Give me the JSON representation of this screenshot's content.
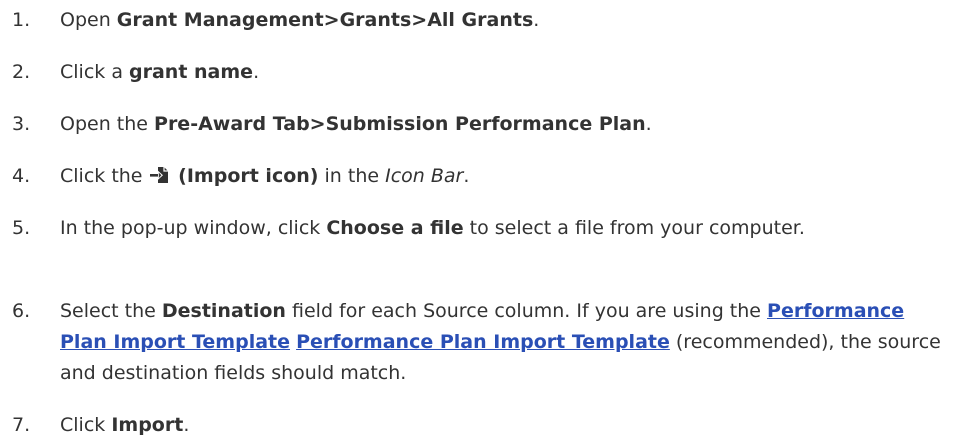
{
  "steps": [
    {
      "number": "1.",
      "pre": "Open ",
      "bold": "Grant Management>Grants>All Grants",
      "post": "."
    },
    {
      "number": "2.",
      "pre": "Click a ",
      "bold": "grant name",
      "post": "."
    },
    {
      "number": "3.",
      "pre": "Open the ",
      "bold": "Pre-Award Tab>Submission Performance Plan",
      "post": "."
    },
    {
      "number": "4.",
      "pre": "Click the ",
      "icon": "import-icon",
      "bold": " (Import icon)",
      "mid": " in the ",
      "italic": "Icon Bar",
      "post": "."
    },
    {
      "number": "5.",
      "pre": "In the pop-up window, click ",
      "bold": "Choose a file",
      "post": " to select a file from your computer."
    },
    {
      "number": "6.",
      "pre": "Select the ",
      "bold": "Destination",
      "mid": " field for each Source column. If you are using the ",
      "link1": "Performance Plan Import Template",
      "link2": "Performance Plan Import Template",
      "post": " (recommended), the source and destination fields should match."
    },
    {
      "number": "7.",
      "pre": "Click ",
      "bold": "Import",
      "post": "."
    }
  ],
  "colors": {
    "text": "#333333",
    "link": "#2a4fb5",
    "icon": "#333333"
  }
}
